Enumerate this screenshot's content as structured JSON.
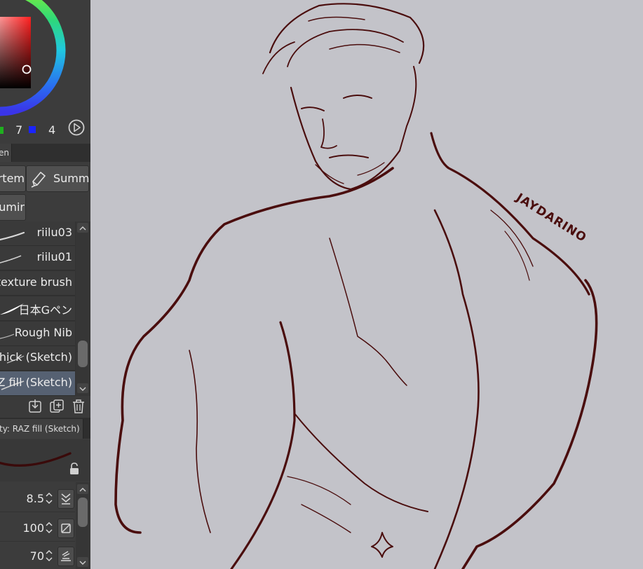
{
  "color": {
    "green_value": "7",
    "blue_value": "4",
    "hue_icon": "color-wheel-icon",
    "play_icon": "play-circle-icon"
  },
  "subtool": {
    "tab_label": "en",
    "group_buttons": [
      "rtem",
      "Summ",
      "umir"
    ],
    "brushes": [
      "riilu03",
      "riilu01",
      "texture brush",
      "日本Gペン",
      "Rough Nib",
      "hick (Sketch)",
      "Z fill (Sketch)"
    ],
    "selected_index": 6
  },
  "actions": {
    "icons": [
      "import-icon",
      "add-subtool-icon",
      "trash-icon"
    ]
  },
  "property": {
    "title": "ty: RAZ fill (Sketch)",
    "lock_icon": "lock-icon",
    "rows": [
      {
        "value": "8.5",
        "icon": "brush-size-icon"
      },
      {
        "value": "100",
        "icon": "opacity-icon"
      },
      {
        "value": "70",
        "icon": "stabilization-icon"
      }
    ]
  },
  "artwork": {
    "signature": "JAYDARINO"
  }
}
